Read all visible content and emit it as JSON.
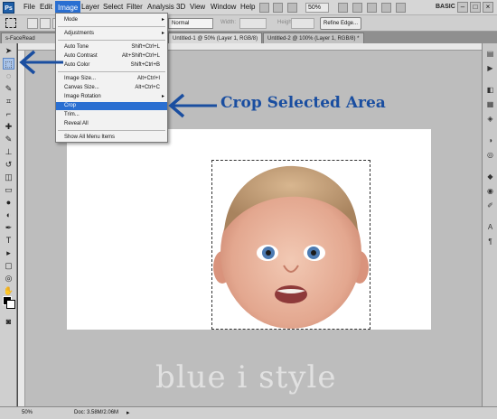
{
  "menubar": {
    "logo": "Ps",
    "items": [
      "File",
      "Edit",
      "Image",
      "Layer",
      "Select",
      "Filter",
      "Analysis",
      "3D",
      "View",
      "Window",
      "Help"
    ],
    "zoom": "50%",
    "workspace": "BASIC"
  },
  "options": {
    "style_value": "Normal",
    "width_label": "Width:",
    "height_label": "Height:",
    "refine_label": "Refine Edge..."
  },
  "tabs": [
    "s-FaceRead",
    "Untitled-1 @ 50% (Layer 1, RGB/8) *",
    "Untitled-2 @ 100% (Layer 1, RGB/8) *"
  ],
  "image_menu": {
    "items": [
      {
        "label": "Mode",
        "shortcut": "",
        "submenu": true
      },
      {
        "label": "Adjustments",
        "shortcut": "",
        "submenu": true
      },
      {
        "label": "Auto Tone",
        "shortcut": "Shift+Ctrl+L",
        "submenu": false
      },
      {
        "label": "Auto Contrast",
        "shortcut": "Alt+Shift+Ctrl+L",
        "submenu": false
      },
      {
        "label": "Auto Color",
        "shortcut": "Shift+Ctrl+B",
        "submenu": false
      },
      {
        "label": "Image Size...",
        "shortcut": "Alt+Ctrl+I",
        "submenu": false
      },
      {
        "label": "Canvas Size...",
        "shortcut": "Alt+Ctrl+C",
        "submenu": false
      },
      {
        "label": "Image Rotation",
        "shortcut": "",
        "submenu": true
      },
      {
        "label": "Crop",
        "shortcut": "",
        "submenu": false
      },
      {
        "label": "Trim...",
        "shortcut": "",
        "submenu": false
      },
      {
        "label": "Reveal All",
        "shortcut": "",
        "submenu": false
      },
      {
        "label": "Show All Menu Items",
        "shortcut": "",
        "submenu": false
      }
    ],
    "highlighted": "Crop"
  },
  "annotation": {
    "crop_label": "Crop Selected Area",
    "arrow_color": "#1a4ea0"
  },
  "statusbar": {
    "zoom": "50%",
    "doc": "Doc: 3.58M/2.06M"
  },
  "watermark": "blue i style",
  "colors": {
    "menu_highlight": "#2a6fd1",
    "canvas_bg": "#bdbdbd",
    "document_bg": "#ffffff"
  }
}
